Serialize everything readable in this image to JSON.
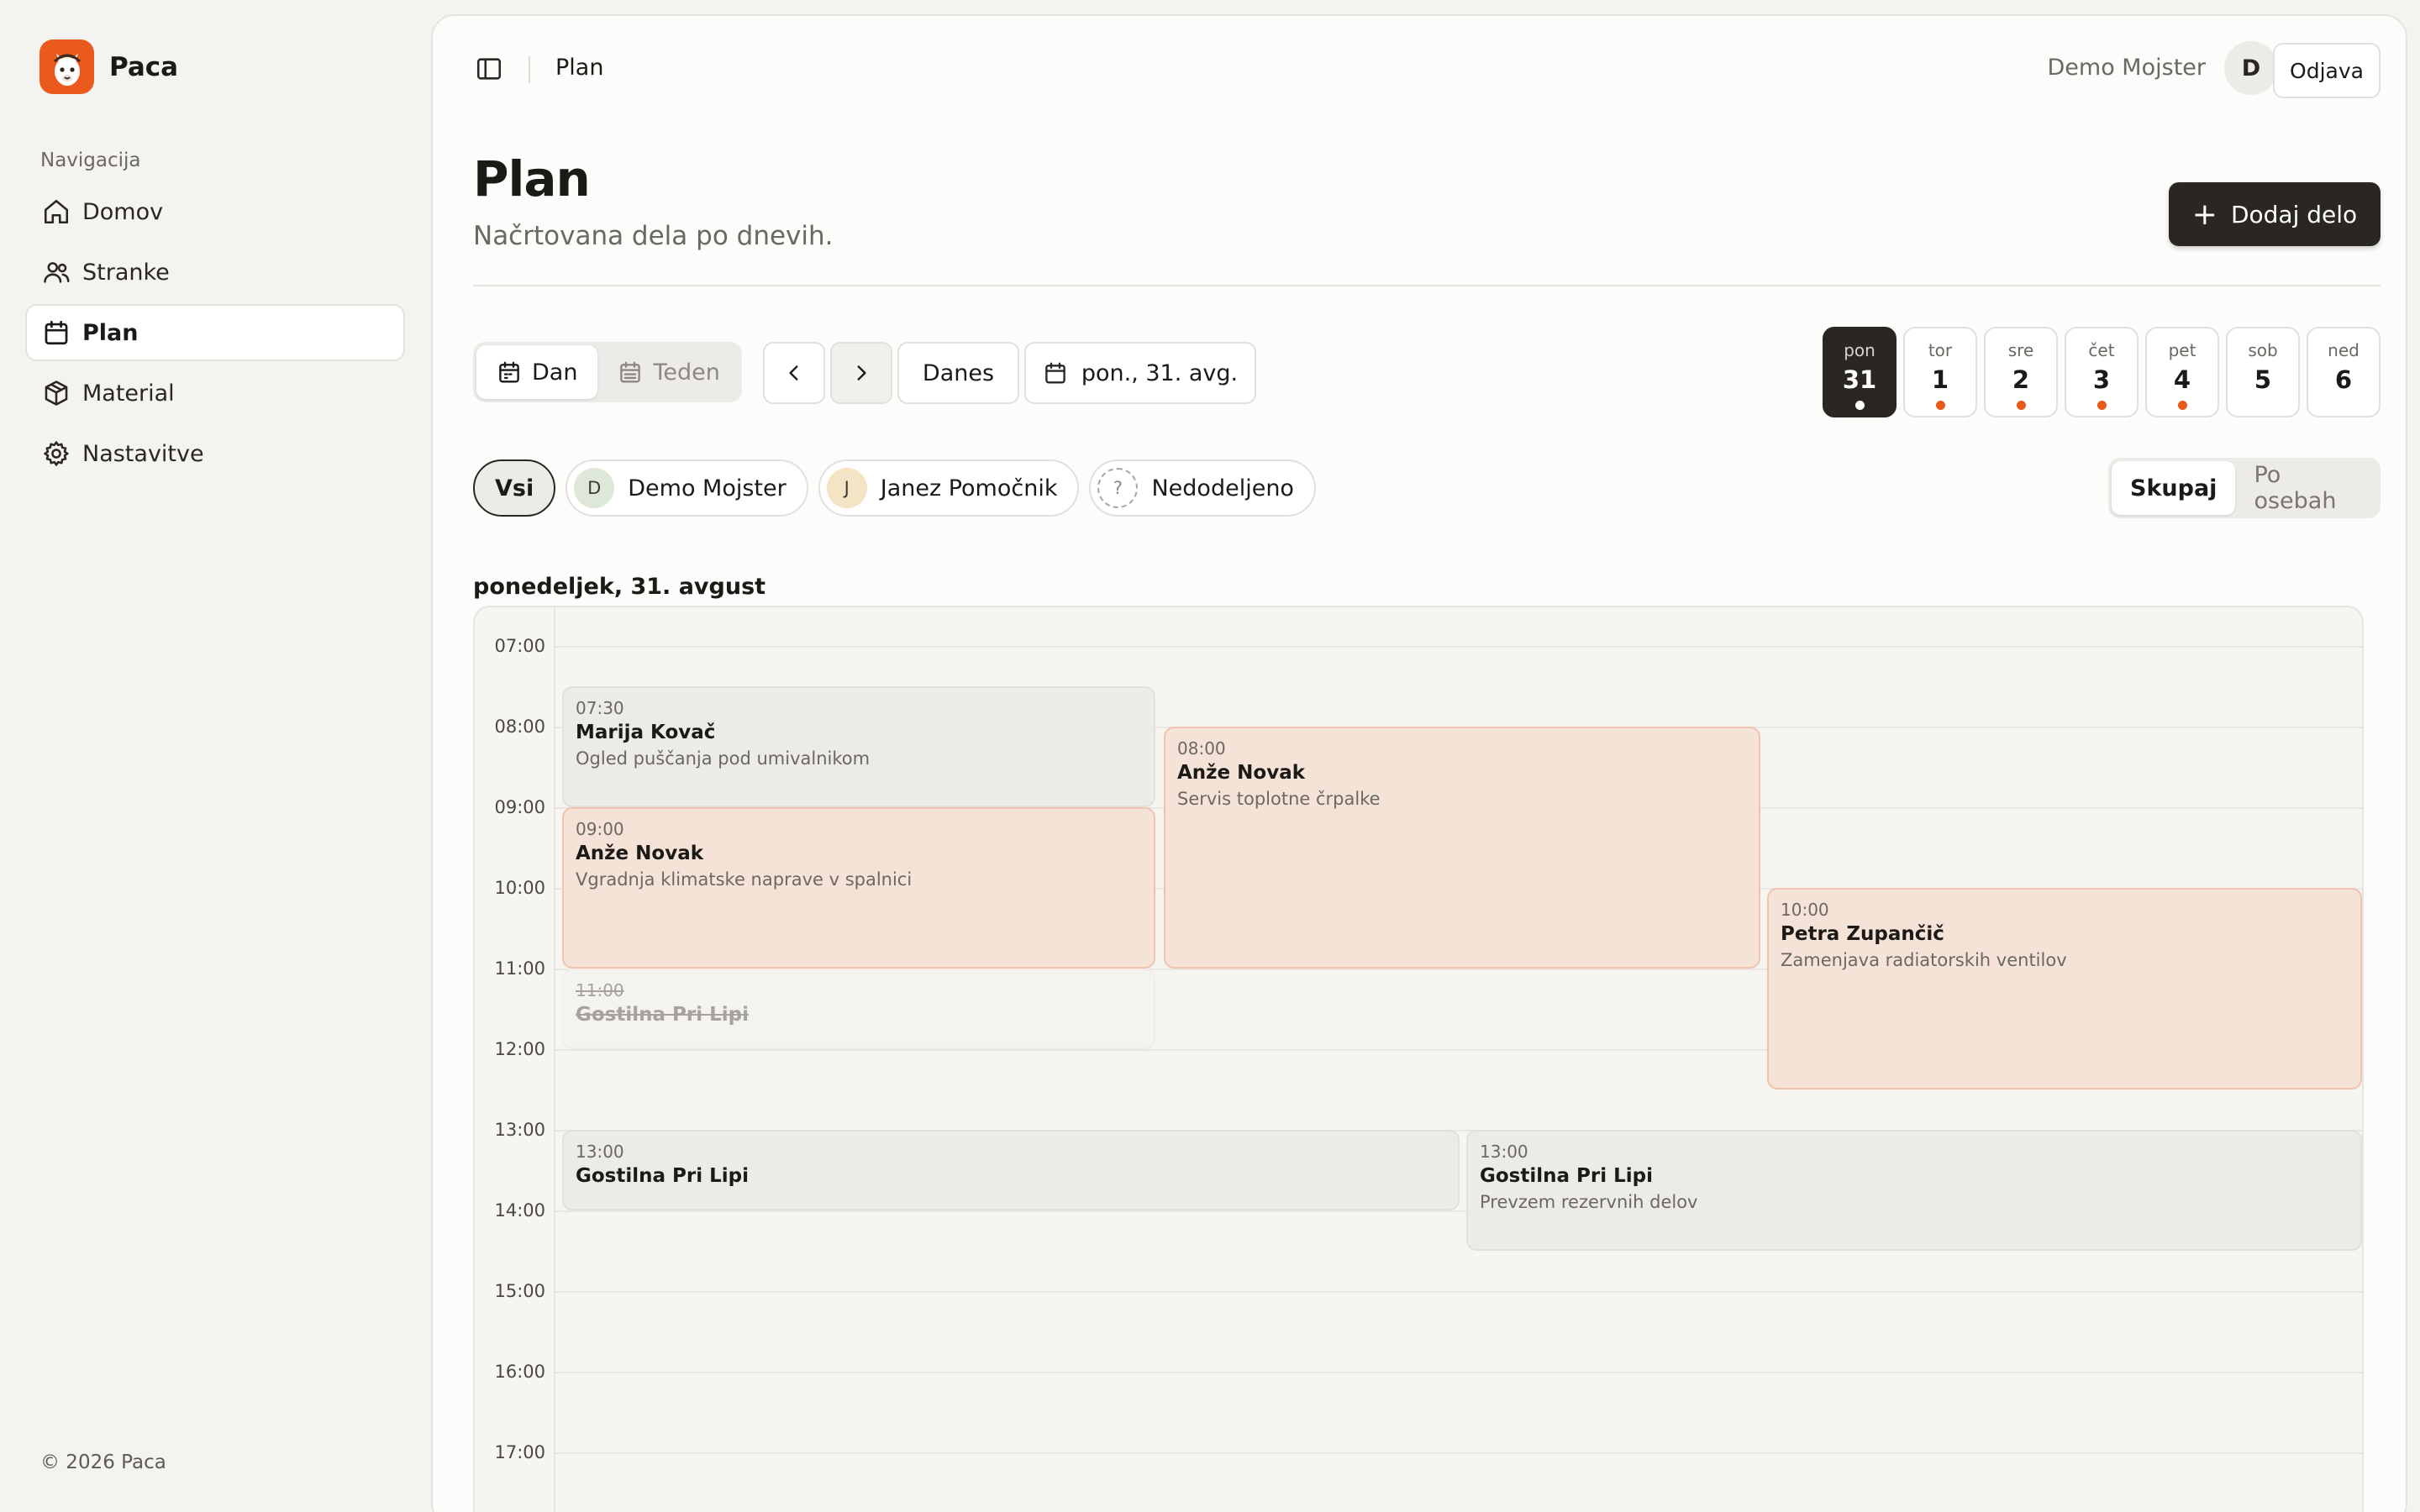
{
  "app": {
    "name": "Paca",
    "copyright": "© 2026 Paca"
  },
  "sidebar": {
    "heading": "Navigacija",
    "items": [
      {
        "label": "Domov",
        "icon": "home-icon"
      },
      {
        "label": "Stranke",
        "icon": "users-icon"
      },
      {
        "label": "Plan",
        "icon": "calendar-icon",
        "active": true
      },
      {
        "label": "Material",
        "icon": "box-icon"
      },
      {
        "label": "Nastavitve",
        "icon": "gear-icon"
      }
    ]
  },
  "topbar": {
    "breadcrumb": "Plan",
    "user_name": "Demo Mojster",
    "user_initial": "D",
    "logout_label": "Odjava"
  },
  "page": {
    "title": "Plan",
    "subtitle": "Načrtovana dela po dnevih.",
    "add_label": "Dodaj delo"
  },
  "toolbar": {
    "view_day": "Dan",
    "view_week": "Teden",
    "today": "Danes",
    "date": "pon., 31. avg."
  },
  "week_days": [
    {
      "wd": "pon",
      "num": "31",
      "dot": true,
      "active": true
    },
    {
      "wd": "tor",
      "num": "1",
      "dot": true
    },
    {
      "wd": "sre",
      "num": "2",
      "dot": true
    },
    {
      "wd": "čet",
      "num": "3",
      "dot": true
    },
    {
      "wd": "pet",
      "num": "4",
      "dot": true
    },
    {
      "wd": "sob",
      "num": "5",
      "dot": false
    },
    {
      "wd": "ned",
      "num": "6",
      "dot": false
    }
  ],
  "filters": {
    "all": "Vsi",
    "people": [
      {
        "initial": "D",
        "name": "Demo Mojster"
      },
      {
        "initial": "J",
        "name": "Janez Pomočnik"
      },
      {
        "initial": "?",
        "name": "Nedodeljeno"
      }
    ],
    "group_together": "Skupaj",
    "group_by_person": "Po osebah"
  },
  "date_heading": "ponedeljek, 31. avgust",
  "hours": [
    "07:00",
    "08:00",
    "09:00",
    "10:00",
    "11:00",
    "12:00",
    "13:00",
    "14:00",
    "15:00",
    "16:00",
    "17:00"
  ],
  "colors": {
    "accent": "#e85a1c",
    "dark": "#2a2622"
  },
  "events": [
    {
      "time": "07:30",
      "title": "Marija Kovač",
      "desc": "Ogled puščanja pod umivalnikom",
      "style": "gray"
    },
    {
      "time": "08:00",
      "title": "Anže Novak",
      "desc": "Servis toplotne črpalke",
      "style": "orange"
    },
    {
      "time": "09:00",
      "title": "Anže Novak",
      "desc": "Vgradnja klimatske naprave v spalnici",
      "style": "orange"
    },
    {
      "time": "10:00",
      "title": "Petra Zupančič",
      "desc": "Zamenjava radiatorskih ventilov",
      "style": "orange"
    },
    {
      "time": "11:00",
      "title": "Gostilna Pri Lipi",
      "desc": "",
      "style": "cancel"
    },
    {
      "time": "13:00",
      "title": "Gostilna Pri Lipi",
      "desc": "",
      "style": "gray"
    },
    {
      "time": "13:00",
      "title": "Gostilna Pri Lipi",
      "desc": "Prevzem rezervnih delov",
      "style": "gray"
    }
  ]
}
